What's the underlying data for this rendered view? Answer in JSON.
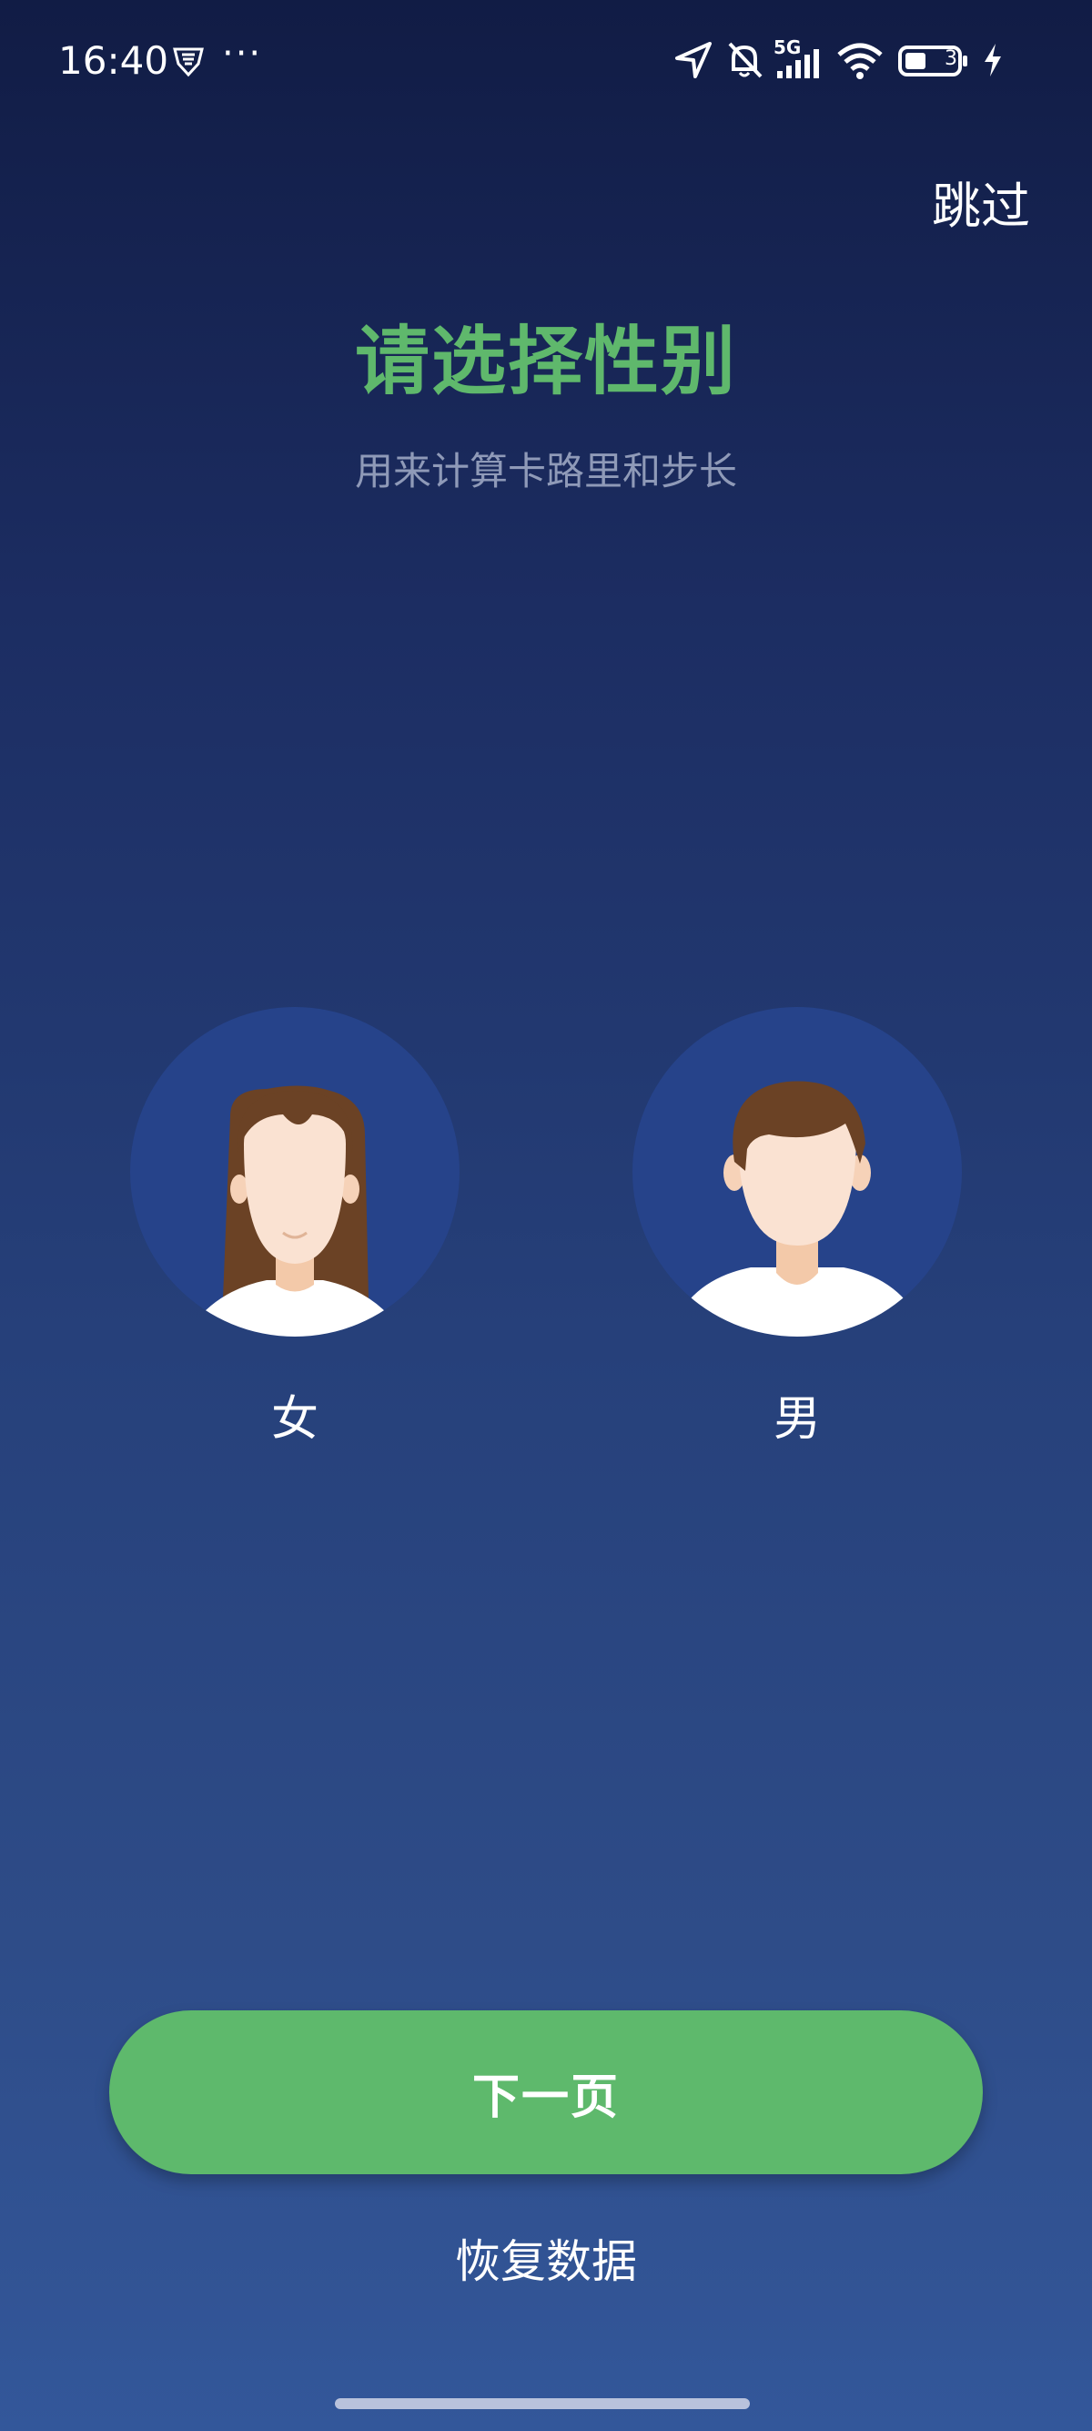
{
  "status_bar": {
    "time": "16:40",
    "dots": "···",
    "network": "5G",
    "battery": "3",
    "icons": [
      "vpn-shield-icon",
      "location-icon",
      "bell-off-icon",
      "signal-icon",
      "wifi-icon",
      "battery-icon",
      "charging-icon"
    ]
  },
  "header": {
    "skip_label": "跳过"
  },
  "main": {
    "title": "请选择性别",
    "subtitle": "用来计算卡路里和步长",
    "options": [
      {
        "label": "女",
        "icon": "female-avatar-icon"
      },
      {
        "label": "男",
        "icon": "male-avatar-icon"
      }
    ]
  },
  "footer": {
    "next_label": "下一页",
    "restore_label": "恢复数据"
  },
  "colors": {
    "accent_green": "#5eb96c",
    "background_top": "#111c45",
    "background_bottom": "#33579a",
    "avatar_bg": "#26438a"
  }
}
